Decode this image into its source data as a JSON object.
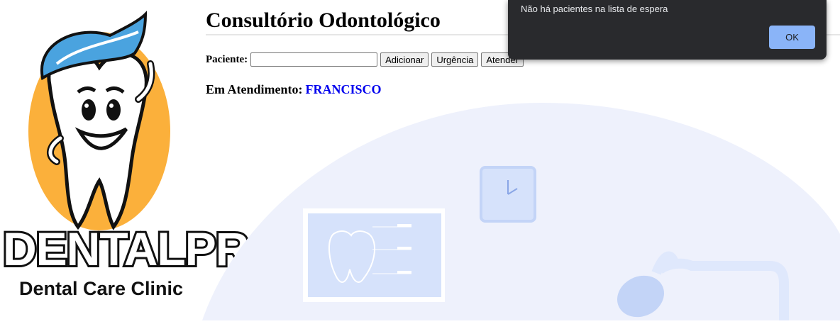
{
  "logo": {
    "brand_name": "DENTALPRO",
    "tagline": "Dental Care Clinic",
    "icon": "tooth-mascot-icon"
  },
  "header": {
    "title": "Consultório Odontológico"
  },
  "form": {
    "patient_label": "Paciente:",
    "patient_value": "",
    "add_label": "Adicionar",
    "urgent_label": "Urgência",
    "attend_label": "Atender"
  },
  "status": {
    "label": "Em Atendimento:",
    "name": "FRANCISCO"
  },
  "alert": {
    "message": "Não há pacientes na lista de espera",
    "ok_label": "OK"
  },
  "colors": {
    "accent_link": "#0000ee",
    "dialog_bg": "#292a2d",
    "dialog_button": "#8ab4f8",
    "illustration_bg": "#eef1fc"
  }
}
